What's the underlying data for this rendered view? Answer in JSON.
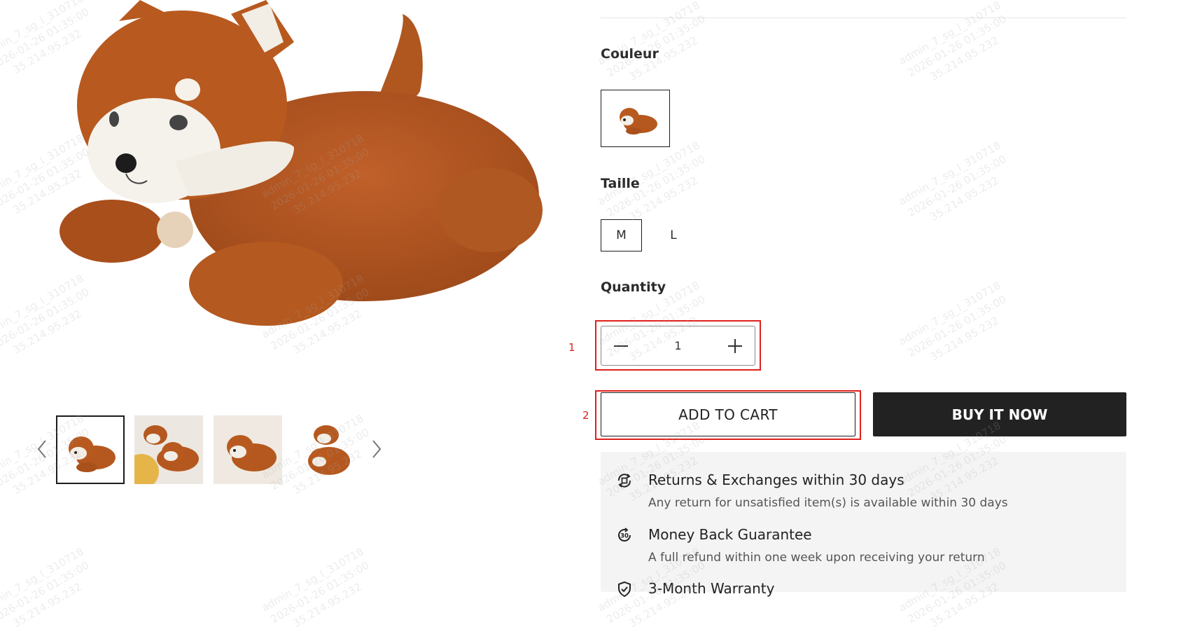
{
  "colors": {
    "accent": "#222222",
    "annotation": "#e0201b",
    "panel": "#f4f4f4"
  },
  "gallery": {
    "main_image": "red panda plush lying down",
    "thumbnails": [
      {
        "icon": "red-panda-plush"
      },
      {
        "icon": "red-panda-plush-pair"
      },
      {
        "icon": "red-panda-plush-lying"
      },
      {
        "icon": "red-panda-plush-stacked"
      }
    ],
    "prev_icon": "chevron-left-icon",
    "next_icon": "chevron-right-icon"
  },
  "options": {
    "color_label": "Couleur",
    "size_label": "Taille",
    "sizes": [
      "M",
      "L"
    ],
    "selected_size": "M"
  },
  "quantity": {
    "label": "Quantity",
    "value": "1"
  },
  "annotations": [
    "1",
    "2"
  ],
  "actions": {
    "add_to_cart": "ADD TO CART",
    "buy_now": "BUY IT NOW"
  },
  "policies": [
    {
      "icon": "return-exchange-icon",
      "title": "Returns & Exchanges within 30 days",
      "desc": "Any return for unsatisfied item(s) is available within 30 days"
    },
    {
      "icon": "money-back-30-icon",
      "title": "Money Back Guarantee",
      "desc": "A full refund within one week upon receiving your return"
    },
    {
      "icon": "shield-check-icon",
      "title": "3-Month Warranty"
    }
  ],
  "watermark": {
    "lines": [
      "admin_7_sg_l_310718",
      "2026-01-26 01:35:00",
      "35.214.95.232"
    ]
  }
}
